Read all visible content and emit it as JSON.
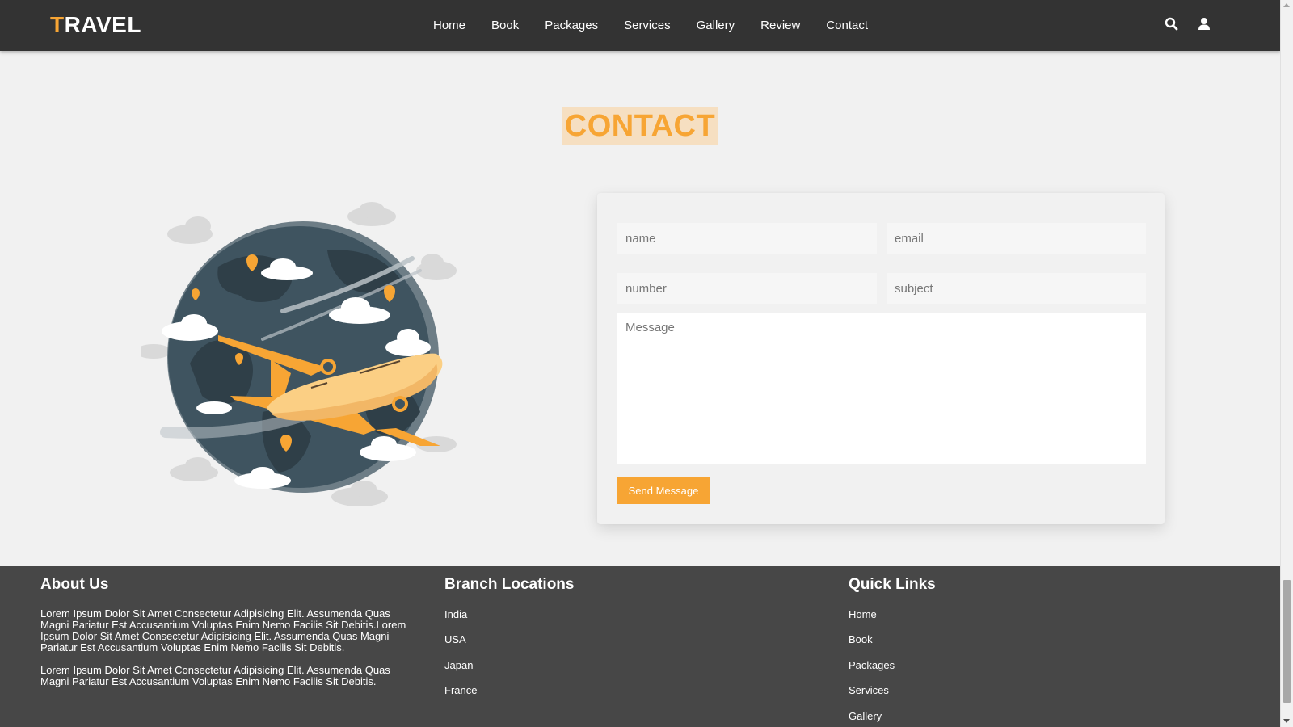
{
  "nav": {
    "logo_first": "T",
    "logo_rest": "RAVEL",
    "links": [
      "Home",
      "Book",
      "Packages",
      "Services",
      "Gallery",
      "Review",
      "Contact"
    ],
    "icons": [
      "search-icon",
      "user-icon"
    ]
  },
  "contact": {
    "heading": "CONTACT",
    "form": {
      "name_placeholder": "name",
      "email_placeholder": "email",
      "number_placeholder": "number",
      "subject_placeholder": "subject",
      "message_placeholder": "Message",
      "send_label": "Send Message"
    }
  },
  "footer": {
    "about": {
      "title": "About Us",
      "p1": "Lorem Ipsum Dolor Sit Amet Consectetur Adipisicing Elit. Assumenda Quas Magni Pariatur Est Accusantium Voluptas Enim Nemo Facilis Sit Debitis.Lorem Ipsum Dolor Sit Amet Consectetur Adipisicing Elit. Assumenda Quas Magni Pariatur Est Accusantium Voluptas Enim Nemo Facilis Sit Debitis.",
      "p2": "Lorem Ipsum Dolor Sit Amet Consectetur Adipisicing Elit. Assumenda Quas Magni Pariatur Est Accusantium Voluptas Enim Nemo Facilis Sit Debitis."
    },
    "branches": {
      "title": "Branch Locations",
      "items": [
        "India",
        "USA",
        "Japan",
        "France"
      ]
    },
    "quick_links": {
      "title": "Quick Links",
      "items": [
        "Home",
        "Book",
        "Packages",
        "Services",
        "Gallery"
      ]
    }
  },
  "colors": {
    "accent": "#f7a534",
    "nav_bg": "#333333",
    "footer_bg": "#474747",
    "page_bg": "#f1f1f1"
  }
}
